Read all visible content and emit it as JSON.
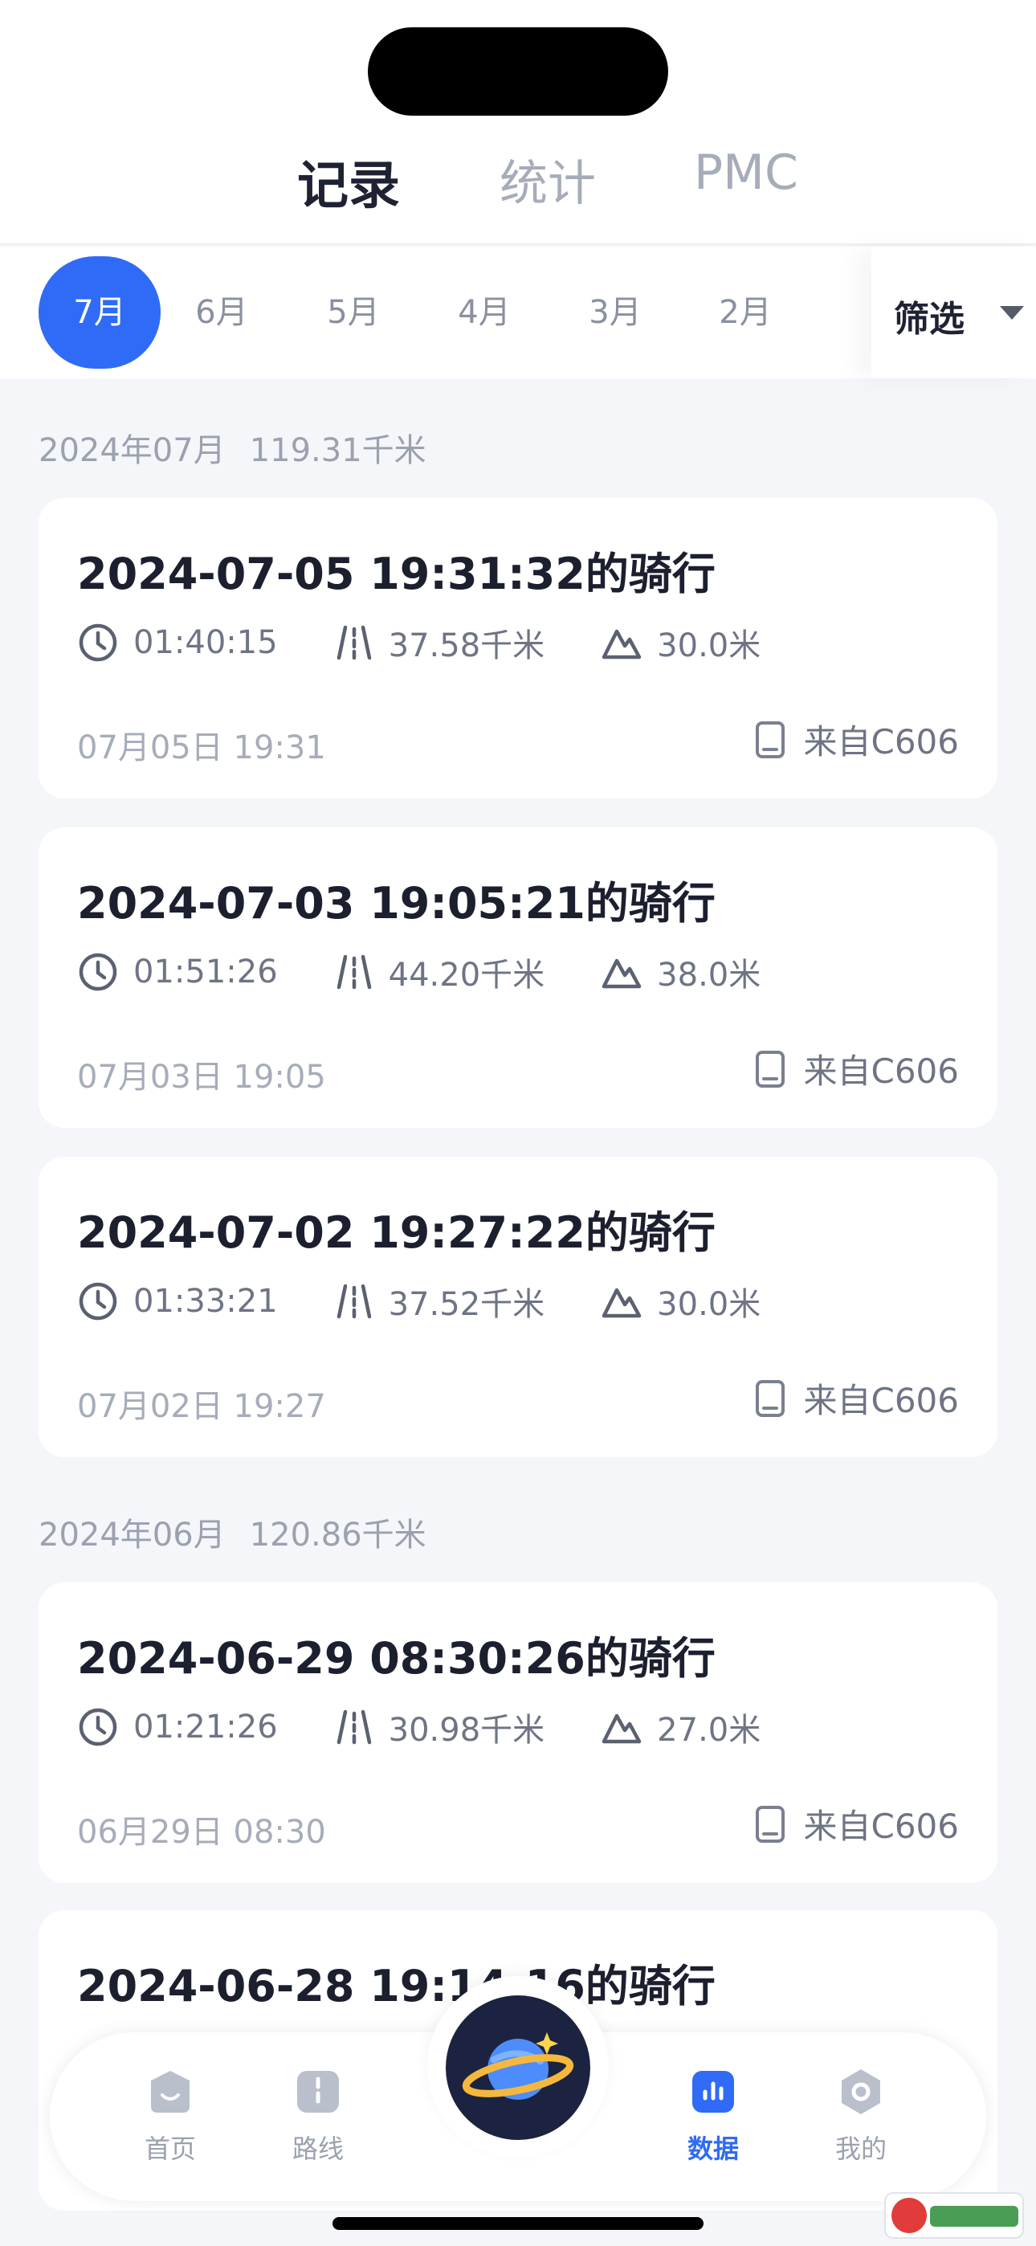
{
  "top_tabs": [
    {
      "label": "记录"
    },
    {
      "label": "统计"
    },
    {
      "label": "PMC"
    }
  ],
  "months": [
    "7月",
    "6月",
    "5月",
    "4月",
    "3月",
    "2月"
  ],
  "active_month": "7月",
  "filter_label": "筛选",
  "groups": [
    {
      "month": "2024年07月",
      "distance": "119.31千米"
    },
    {
      "month": "2024年06月",
      "distance": "120.86千米"
    }
  ],
  "rides": [
    {
      "title": "2024-07-05 19:31:32的骑行",
      "duration": "01:40:15",
      "distance": "37.58千米",
      "elevation": "30.0米",
      "date": "07月05日 19:31",
      "source": "来自C606"
    },
    {
      "title": "2024-07-03 19:05:21的骑行",
      "duration": "01:51:26",
      "distance": "44.20千米",
      "elevation": "38.0米",
      "date": "07月03日 19:05",
      "source": "来自C606"
    },
    {
      "title": "2024-07-02 19:27:22的骑行",
      "duration": "01:33:21",
      "distance": "37.52千米",
      "elevation": "30.0米",
      "date": "07月02日 19:27",
      "source": "来自C606"
    },
    {
      "title": "2024-06-29 08:30:26的骑行",
      "duration": "01:21:26",
      "distance": "30.98千米",
      "elevation": "27.0米",
      "date": "06月29日 08:30",
      "source": "来自C606"
    },
    {
      "title": "2024-06-28 19:14:16的骑行"
    }
  ],
  "bottom_tabs": [
    {
      "label": "首页",
      "icon": "home-icon"
    },
    {
      "label": "路线",
      "icon": "route-icon"
    },
    {
      "label": "数据",
      "icon": "data-chart-icon",
      "active": true
    },
    {
      "label": "我的",
      "icon": "profile-icon"
    }
  ],
  "center_button_icon": "planet-icon",
  "colors": {
    "accent": "#2f6bf6",
    "background": "#f4f6fa",
    "card": "#ffffff"
  }
}
